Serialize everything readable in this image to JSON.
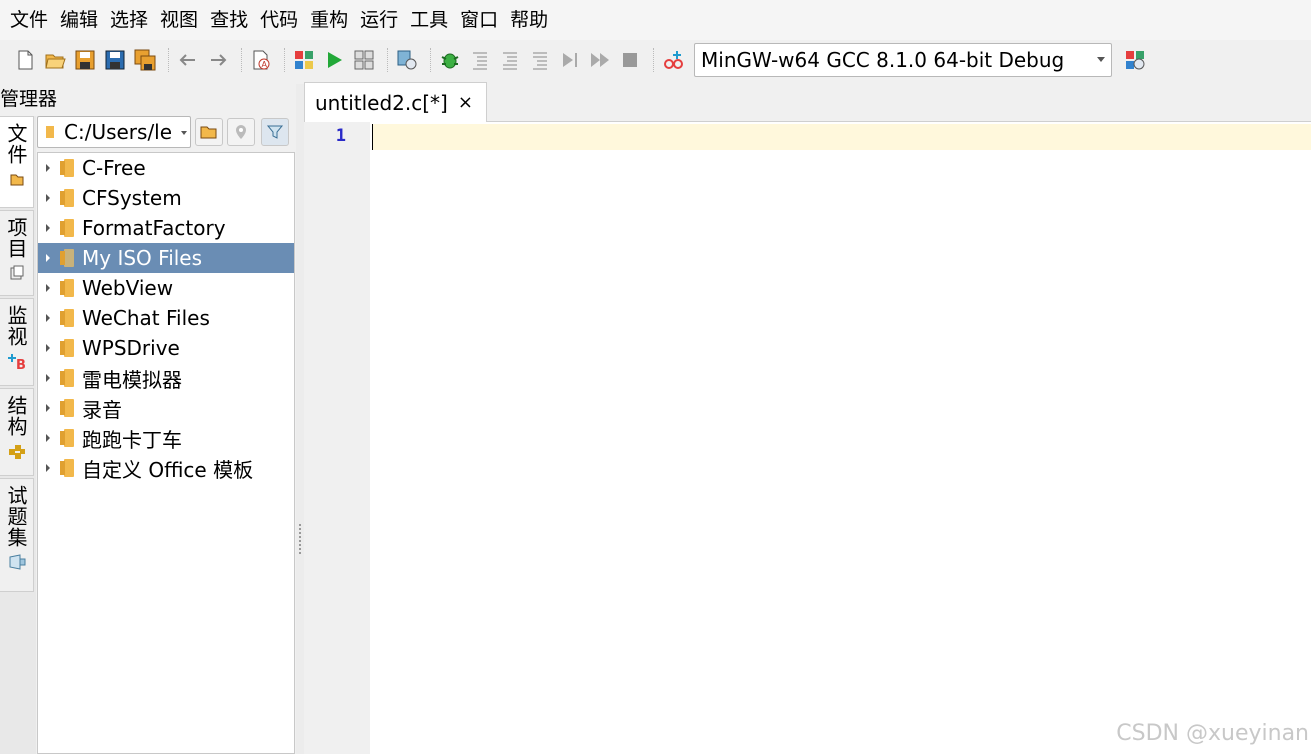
{
  "menu": [
    "文件",
    "编辑",
    "选择",
    "视图",
    "查找",
    "代码",
    "重构",
    "运行",
    "工具",
    "窗口",
    "帮助"
  ],
  "toolbar": {
    "compiler": "MinGW-w64 GCC 8.1.0 64-bit Debug"
  },
  "manager": {
    "title": "管理器",
    "side_tabs": [
      "文件",
      "项目",
      "监视",
      "结构",
      "试题集"
    ],
    "path": "C:/Users/le",
    "tree": [
      {
        "label": "C-Free"
      },
      {
        "label": "CFSystem"
      },
      {
        "label": "FormatFactory"
      },
      {
        "label": "My ISO Files",
        "selected": true
      },
      {
        "label": "WebView"
      },
      {
        "label": "WeChat Files"
      },
      {
        "label": "WPSDrive"
      },
      {
        "label": "雷电模拟器"
      },
      {
        "label": "录音"
      },
      {
        "label": "跑跑卡丁车"
      },
      {
        "label": "自定义 Office 模板"
      }
    ]
  },
  "editor": {
    "tab_title": "untitled2.c[*]",
    "tab_close": "×",
    "line_numbers": [
      "1"
    ]
  },
  "watermark": "CSDN @xueyinan"
}
